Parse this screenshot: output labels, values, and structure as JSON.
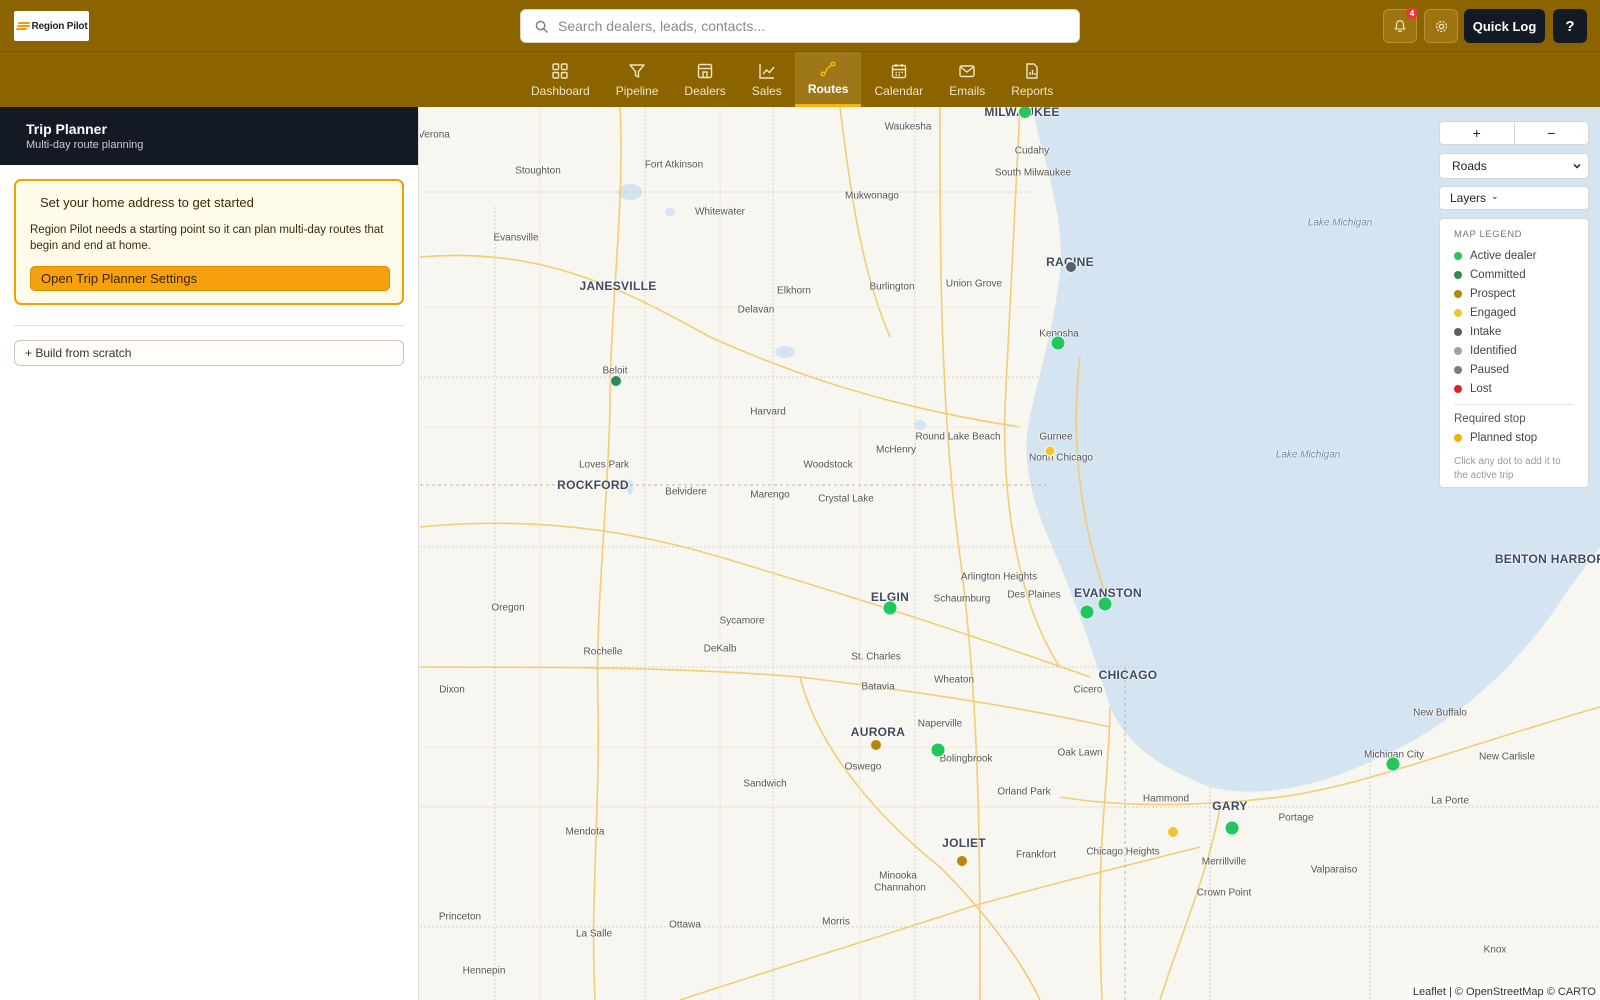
{
  "header": {
    "logo_text": "Region Pilot",
    "search_placeholder": "Search dealers, leads, contacts...",
    "notification_count": "4",
    "quick_log_label": "Quick Log",
    "help_label": "?"
  },
  "nav": {
    "tabs": [
      {
        "label": "Dashboard",
        "icon": "grid-icon"
      },
      {
        "label": "Pipeline",
        "icon": "funnel-icon"
      },
      {
        "label": "Dealers",
        "icon": "storefront-icon"
      },
      {
        "label": "Sales",
        "icon": "trend-chart-icon"
      },
      {
        "label": "Routes",
        "icon": "route-icon"
      },
      {
        "label": "Calendar",
        "icon": "calendar-icon"
      },
      {
        "label": "Emails",
        "icon": "mail-icon"
      },
      {
        "label": "Reports",
        "icon": "report-icon"
      }
    ],
    "active": "Routes"
  },
  "sidebar": {
    "title": "Trip Planner",
    "subtitle": "Multi-day route planning",
    "card": {
      "title": "Set your home address to get started",
      "body": "Region Pilot needs a starting point so it can plan multi-day routes that begin and end at home.",
      "button": "Open Trip Planner Settings"
    },
    "build_button": "+ Build from scratch"
  },
  "map": {
    "zoom_in": "+",
    "zoom_out": "−",
    "basemap_selected": "Roads",
    "layers_label": "Layers",
    "layers_caret": "⌄",
    "legend": {
      "title": "MAP LEGEND",
      "items": [
        {
          "label": "Active dealer",
          "color": "#22c55e"
        },
        {
          "label": "Committed",
          "color": "#2e8b57"
        },
        {
          "label": "Prospect",
          "color": "#b8860b"
        },
        {
          "label": "Engaged",
          "color": "#f4c430"
        },
        {
          "label": "Intake",
          "color": "#5a5f69"
        },
        {
          "label": "Identified",
          "color": "#9ca3af"
        },
        {
          "label": "Paused",
          "color": "#7b7b7b"
        },
        {
          "label": "Lost",
          "color": "#dc2626"
        }
      ],
      "required_label": "Required stop",
      "planned_label": "Planned stop",
      "planned_color": "#f0b400",
      "note": "Click any dot to add it to the active trip"
    },
    "attribution": "Leaflet | © OpenStreetMap © CARTO",
    "places": [
      {
        "name": "MILWAUKEE",
        "big": true
      },
      {
        "name": "Waukesha"
      },
      {
        "name": "Verona"
      },
      {
        "name": "Fort Atkinson"
      },
      {
        "name": "Stoughton"
      },
      {
        "name": "Cudahy"
      },
      {
        "name": "South Milwaukee"
      },
      {
        "name": "Mukwonago"
      },
      {
        "name": "Whitewater"
      },
      {
        "name": "Lake Michigan",
        "water": true
      },
      {
        "name": "Evansville"
      },
      {
        "name": "RACINE",
        "big": true
      },
      {
        "name": "JANESVILLE",
        "big": true
      },
      {
        "name": "Elkhorn"
      },
      {
        "name": "Burlington"
      },
      {
        "name": "Union Grove"
      },
      {
        "name": "Delavan"
      },
      {
        "name": "Kenosha"
      },
      {
        "name": "Beloit"
      },
      {
        "name": "Harvard"
      },
      {
        "name": "Round Lake Beach"
      },
      {
        "name": "Gurnee"
      },
      {
        "name": "McHenry"
      },
      {
        "name": "North Chicago"
      },
      {
        "name": "Lake Michigan",
        "water": true
      },
      {
        "name": "Loves Park"
      },
      {
        "name": "Woodstock"
      },
      {
        "name": "ROCKFORD",
        "big": true
      },
      {
        "name": "Belvidere"
      },
      {
        "name": "Marengo"
      },
      {
        "name": "Crystal Lake"
      },
      {
        "name": "Arlington Heights"
      },
      {
        "name": "BENTON HARBOR",
        "big": true
      },
      {
        "name": "ELGIN",
        "big": true
      },
      {
        "name": "Schaumburg"
      },
      {
        "name": "Des Plaines"
      },
      {
        "name": "EVANSTON",
        "big": true
      },
      {
        "name": "Oregon"
      },
      {
        "name": "Sycamore"
      },
      {
        "name": "Rochelle"
      },
      {
        "name": "DeKalb"
      },
      {
        "name": "St. Charles"
      },
      {
        "name": "CHICAGO",
        "big": true
      },
      {
        "name": "Wheaton"
      },
      {
        "name": "Dixon"
      },
      {
        "name": "Batavia"
      },
      {
        "name": "Cicero"
      },
      {
        "name": "New Buffalo"
      },
      {
        "name": "Naperville"
      },
      {
        "name": "AURORA",
        "big": true
      },
      {
        "name": "Oak Lawn"
      },
      {
        "name": "Michigan City"
      },
      {
        "name": "New Carlisle"
      },
      {
        "name": "Bolingbrook"
      },
      {
        "name": "Oswego"
      },
      {
        "name": "Sandwich"
      },
      {
        "name": "Orland Park"
      },
      {
        "name": "Hammond"
      },
      {
        "name": "La Porte"
      },
      {
        "name": "GARY",
        "big": true
      },
      {
        "name": "Portage"
      },
      {
        "name": "Mendota"
      },
      {
        "name": "JOLIET",
        "big": true
      },
      {
        "name": "Frankfort"
      },
      {
        "name": "Chicago Heights"
      },
      {
        "name": "Merrillville"
      },
      {
        "name": "Valparaiso"
      },
      {
        "name": "Minooka"
      },
      {
        "name": "Channahon"
      },
      {
        "name": "Crown Point"
      },
      {
        "name": "Princeton"
      },
      {
        "name": "La Salle"
      },
      {
        "name": "Ottawa"
      },
      {
        "name": "Morris"
      },
      {
        "name": "Knox"
      },
      {
        "name": "Hennepin"
      }
    ]
  }
}
